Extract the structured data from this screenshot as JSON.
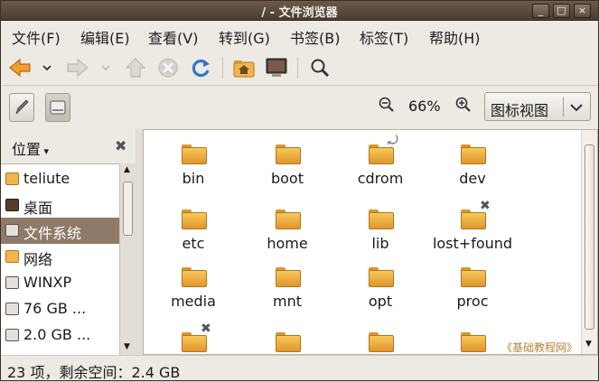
{
  "window": {
    "title": "/ - 文件浏览器",
    "controls": [
      "_",
      "□",
      "×"
    ]
  },
  "menu": [
    "文件(F)",
    "编辑(E)",
    "查看(V)",
    "转到(G)",
    "书签(B)",
    "标签(T)",
    "帮助(H)"
  ],
  "toolbar2": {
    "zoom_level": "66%",
    "view_mode": "图标视图"
  },
  "sidebar": {
    "header": "位置",
    "items": [
      {
        "label": "teliute",
        "icon": "home-folder-icon"
      },
      {
        "label": "桌面",
        "icon": "desktop-icon"
      },
      {
        "label": "文件系统",
        "icon": "drive-icon",
        "selected": true
      },
      {
        "label": "网络",
        "icon": "network-icon"
      },
      {
        "label": "WINXP",
        "icon": "drive-icon"
      },
      {
        "label": "76 GB ...",
        "icon": "drive-icon"
      },
      {
        "label": "2.0 GB ...",
        "icon": "drive-icon"
      }
    ]
  },
  "folders": [
    "bin",
    "boot",
    "cdrom",
    "dev",
    "etc",
    "home",
    "lib",
    "lost+found",
    "media",
    "mnt",
    "opt",
    "proc",
    "",
    "",
    "",
    ""
  ],
  "watermark": "《基础教程网》",
  "status": {
    "text": "23 项，剩余空间：2.4 GB"
  },
  "colors": {
    "titlebar": "#5a4a3c",
    "selection": "#8e7a68",
    "folder": "#f0b445",
    "accent": "#e07b1a"
  }
}
